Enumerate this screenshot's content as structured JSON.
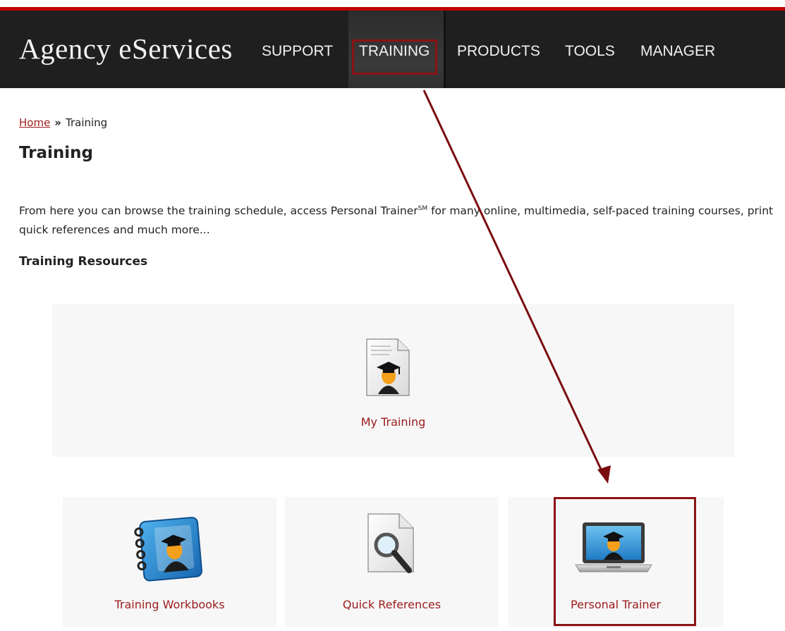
{
  "header": {
    "brand": "Agency eServices",
    "nav": [
      {
        "label": "SUPPORT"
      },
      {
        "label": "TRAINING",
        "active": true
      },
      {
        "label": "PRODUCTS"
      },
      {
        "label": "TOOLS"
      },
      {
        "label": "MANAGER"
      }
    ]
  },
  "breadcrumb": {
    "home": "Home",
    "separator": "»",
    "current": "Training"
  },
  "page": {
    "title": "Training",
    "intro_before": "From here you can browse the training schedule, access Personal Trainer",
    "intro_sup": "SM",
    "intro_after": " for many online, multimedia, self-paced training courses, print quick references and much more...",
    "section_title": "Training Resources"
  },
  "tiles": {
    "my_training": {
      "label": "My Training",
      "icon": "graduate-document-icon"
    },
    "workbooks": {
      "label": "Training Workbooks",
      "icon": "graduate-notebook-icon"
    },
    "quick_references": {
      "label": "Quick References",
      "icon": "magnifier-document-icon"
    },
    "personal_trainer": {
      "label": "Personal Trainer",
      "icon": "graduate-laptop-icon"
    }
  },
  "colors": {
    "accent": "#c00000",
    "highlight": "#8b1214",
    "nav_bg": "#1f1f1f",
    "link": "#9b1b1b"
  }
}
